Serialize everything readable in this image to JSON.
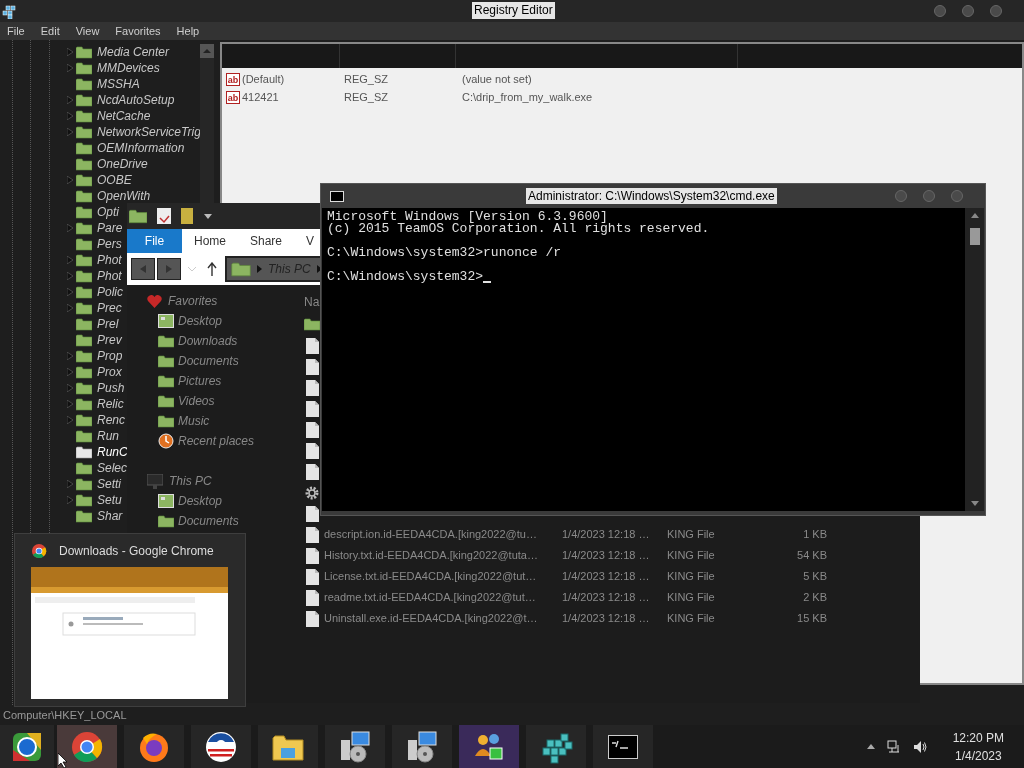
{
  "registry_window": {
    "title": "Registry Editor",
    "menu": [
      "File",
      "Edit",
      "View",
      "Favorites",
      "Help"
    ],
    "tree": [
      {
        "label": "Media Center",
        "expandable": true,
        "selected": false
      },
      {
        "label": "MMDevices",
        "expandable": true,
        "selected": false
      },
      {
        "label": "MSSHA",
        "expandable": false,
        "selected": false
      },
      {
        "label": "NcdAutoSetup",
        "expandable": true,
        "selected": false
      },
      {
        "label": "NetCache",
        "expandable": true,
        "selected": false
      },
      {
        "label": "NetworkServiceTrig",
        "expandable": true,
        "selected": false
      },
      {
        "label": "OEMInformation",
        "expandable": false,
        "selected": false
      },
      {
        "label": "OneDrive",
        "expandable": false,
        "selected": false
      },
      {
        "label": "OOBE",
        "expandable": true,
        "selected": false
      },
      {
        "label": "OpenWith",
        "expandable": false,
        "selected": false
      },
      {
        "label": "Opti",
        "expandable": false,
        "selected": false
      },
      {
        "label": "Pare",
        "expandable": true,
        "selected": false
      },
      {
        "label": "Pers",
        "expandable": false,
        "selected": false
      },
      {
        "label": "Phot",
        "expandable": true,
        "selected": false
      },
      {
        "label": "Phot",
        "expandable": true,
        "selected": false
      },
      {
        "label": "Polic",
        "expandable": true,
        "selected": false
      },
      {
        "label": "Prec",
        "expandable": true,
        "selected": false
      },
      {
        "label": "Prel",
        "expandable": false,
        "selected": false
      },
      {
        "label": "Prev",
        "expandable": false,
        "selected": false
      },
      {
        "label": "Prop",
        "expandable": true,
        "selected": false
      },
      {
        "label": "Prox",
        "expandable": true,
        "selected": false
      },
      {
        "label": "Push",
        "expandable": true,
        "selected": false
      },
      {
        "label": "Relic",
        "expandable": true,
        "selected": false
      },
      {
        "label": "Renc",
        "expandable": true,
        "selected": false
      },
      {
        "label": "Run",
        "expandable": false,
        "selected": false
      },
      {
        "label": "RunC",
        "expandable": false,
        "selected": true
      },
      {
        "label": "Selec",
        "expandable": false,
        "selected": false
      },
      {
        "label": "Setti",
        "expandable": true,
        "selected": false
      },
      {
        "label": "Setu",
        "expandable": true,
        "selected": false
      },
      {
        "label": "Shar",
        "expandable": false,
        "selected": false
      }
    ],
    "values": [
      {
        "icon": "ab",
        "name": "(Default)",
        "type": "REG_SZ",
        "data": "(value not set)"
      },
      {
        "icon": "ab",
        "name": "412421",
        "type": "REG_SZ",
        "data": "C:\\drip_from_my_walk.exe"
      }
    ],
    "status_bar": "Computer\\HKEY_LOCAL"
  },
  "explorer_window": {
    "ribbon_tabs": [
      {
        "label": "File",
        "selected": true
      },
      {
        "label": "Home",
        "selected": false
      },
      {
        "label": "Share",
        "selected": false
      },
      {
        "label": "V",
        "selected": false
      }
    ],
    "address": "This PC",
    "nav": [
      {
        "label": "Favorites",
        "kind": "favorites",
        "children": [
          {
            "label": "Desktop",
            "kind": "desktop"
          },
          {
            "label": "Downloads",
            "kind": "downloads"
          },
          {
            "label": "Documents",
            "kind": "documents"
          },
          {
            "label": "Pictures",
            "kind": "pictures"
          },
          {
            "label": "Videos",
            "kind": "videos"
          },
          {
            "label": "Music",
            "kind": "music"
          },
          {
            "label": "Recent places",
            "kind": "recent"
          }
        ]
      },
      {
        "label": "This PC",
        "kind": "computer",
        "children": [
          {
            "label": "Desktop",
            "kind": "desktop"
          },
          {
            "label": "Documents",
            "kind": "documents"
          }
        ]
      }
    ],
    "column_header": "Na",
    "files": [
      {
        "kind": "folder"
      },
      {
        "kind": "file"
      },
      {
        "kind": "file"
      },
      {
        "kind": "file"
      },
      {
        "kind": "file"
      },
      {
        "kind": "file"
      },
      {
        "kind": "file"
      },
      {
        "kind": "file"
      },
      {
        "kind": "settings"
      },
      {
        "kind": "file"
      },
      {
        "kind": "file",
        "name": "descript.ion.id-EEDA4CDA.[king2022@tu…",
        "date": "1/4/2023 12:18 …",
        "type": "KING File",
        "size": "1 KB"
      },
      {
        "kind": "file",
        "name": "History.txt.id-EEDA4CDA.[king2022@tuta…",
        "date": "1/4/2023 12:18 …",
        "type": "KING File",
        "size": "54 KB"
      },
      {
        "kind": "file",
        "name": "License.txt.id-EEDA4CDA.[king2022@tut…",
        "date": "1/4/2023 12:18 …",
        "type": "KING File",
        "size": "5 KB"
      },
      {
        "kind": "file",
        "name": "readme.txt.id-EEDA4CDA.[king2022@tut…",
        "date": "1/4/2023 12:18 …",
        "type": "KING File",
        "size": "2 KB"
      },
      {
        "kind": "file",
        "name": "Uninstall.exe.id-EEDA4CDA.[king2022@t…",
        "date": "1/4/2023 12:18 …",
        "type": "KING File",
        "size": "15 KB"
      }
    ]
  },
  "cmd_window": {
    "title": "Administrator: C:\\Windows\\System32\\cmd.exe",
    "blocks": [
      [
        "Microsoft Windows [Version 6.3.9600]",
        "(c) 2015 TeamOS Corporation. All rights reserved."
      ],
      [
        "C:\\Windows\\system32>runonce /r"
      ],
      [
        "C:\\Windows\\system32>"
      ]
    ],
    "cursor": true
  },
  "thumbnail": {
    "title": "Downloads - Google Chrome"
  },
  "taskbar": {
    "apps": [
      {
        "kind": "globe",
        "selected": false
      },
      {
        "kind": "ring",
        "selected": true
      },
      {
        "kind": "fox",
        "selected": false
      },
      {
        "kind": "stripes",
        "selected": false
      },
      {
        "kind": "folder",
        "selected": false
      },
      {
        "kind": "installer",
        "selected": false
      },
      {
        "kind": "installer",
        "selected": false
      },
      {
        "kind": "people",
        "selected": false
      },
      {
        "kind": "cubes",
        "selected": false
      },
      {
        "kind": "terminal",
        "selected": false
      }
    ],
    "time": "12:20 PM",
    "date": "1/4/2023"
  }
}
